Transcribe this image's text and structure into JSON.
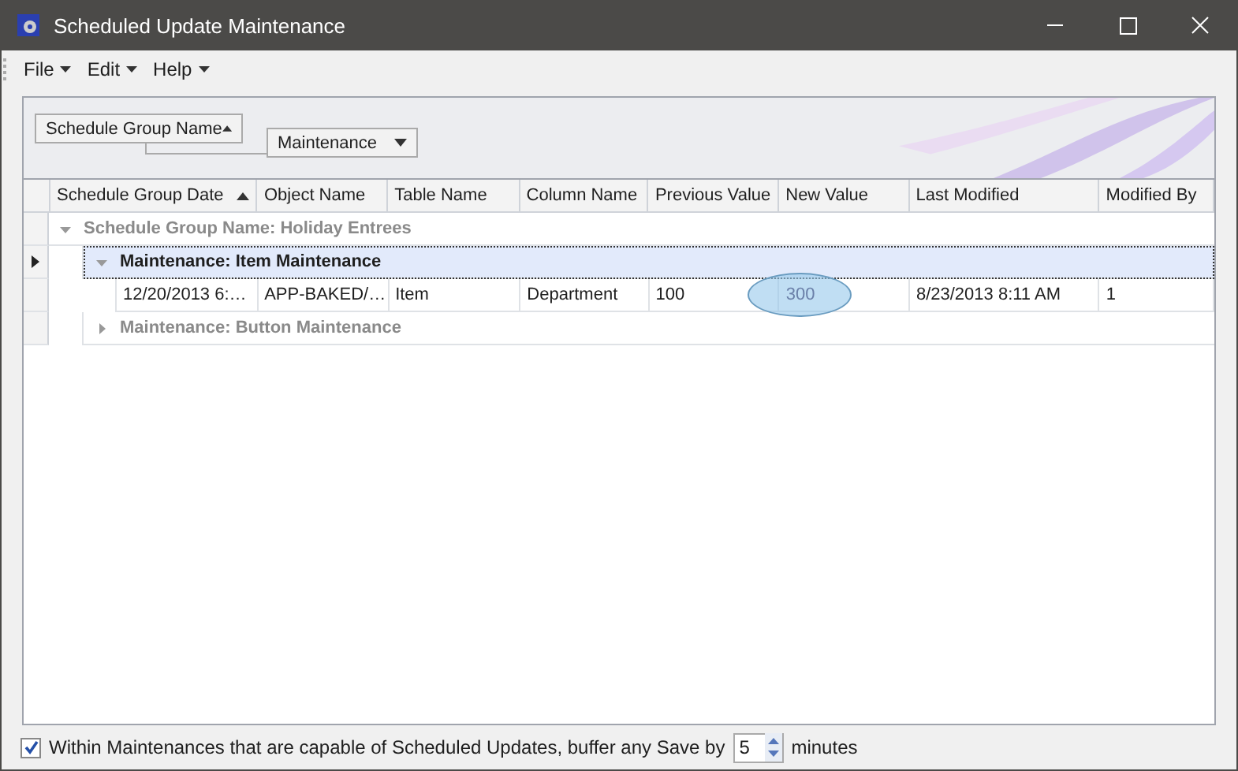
{
  "window": {
    "title": "Scheduled Update Maintenance"
  },
  "menu": [
    {
      "label": "File"
    },
    {
      "label": "Edit"
    },
    {
      "label": "Help"
    }
  ],
  "group_panel": [
    {
      "label": "Schedule Group Name",
      "descending": false
    },
    {
      "label": "Maintenance",
      "descending": true
    }
  ],
  "columns": [
    {
      "label": "Schedule Group Date",
      "sorted": true
    },
    {
      "label": "Object Name",
      "sorted": false
    },
    {
      "label": "Table Name",
      "sorted": false
    },
    {
      "label": "Column Name",
      "sorted": false
    },
    {
      "label": "Previous Value",
      "sorted": false
    },
    {
      "label": "New Value",
      "sorted": false
    },
    {
      "label": "Last Modified",
      "sorted": false
    },
    {
      "label": "Modified By",
      "sorted": false
    }
  ],
  "groups": [
    {
      "label": "Schedule Group Name: Holiday Entrees",
      "expanded": true,
      "selected": false,
      "children": [
        {
          "label": "Maintenance: Item Maintenance",
          "expanded": true,
          "selected": true,
          "rows": [
            {
              "cells": [
                {
                  "text": "12/20/2013 6:…",
                  "circled": false
                },
                {
                  "text": "APP-BAKED/…",
                  "circled": false
                },
                {
                  "text": "Item",
                  "circled": false
                },
                {
                  "text": "Department",
                  "circled": false
                },
                {
                  "text": "100",
                  "circled": false
                },
                {
                  "text": "300",
                  "circled": true
                },
                {
                  "text": "8/23/2013 8:11 AM",
                  "circled": false
                },
                {
                  "text": "1",
                  "circled": false
                }
              ]
            }
          ]
        },
        {
          "label": "Maintenance: Button Maintenance",
          "expanded": false,
          "selected": false
        }
      ]
    }
  ],
  "footer": {
    "checked": true,
    "text": "Within Maintenances that are capable of Scheduled Updates, buffer any Save by",
    "value": "5",
    "unit": "minutes"
  }
}
